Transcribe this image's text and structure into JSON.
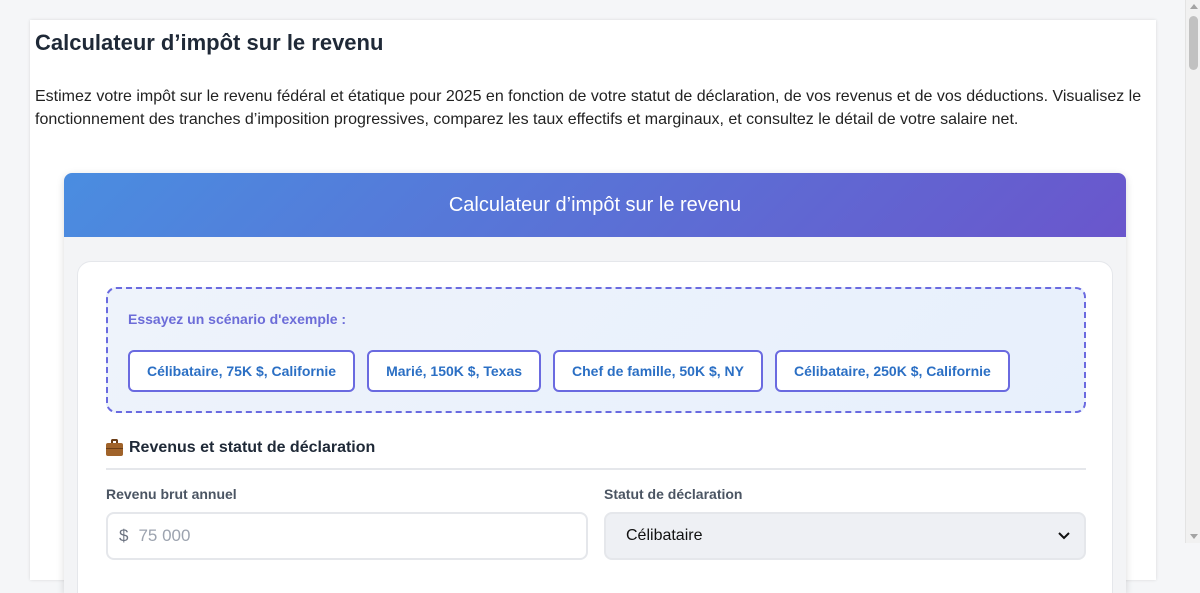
{
  "page": {
    "title": "Calculateur d’impôt sur le revenu",
    "intro": "Estimez votre impôt sur le revenu fédéral et étatique pour 2025 en fonction de votre statut de déclaration, de vos revenus et de vos déductions. Visualisez le fonctionnement des tranches d’imposition progressives, comparez les taux effectifs et marginaux, et consultez le détail de votre salaire net."
  },
  "calculator": {
    "header": "Calculateur d’impôt sur le revenu",
    "scenarios": {
      "label": "Essayez un scénario d'exemple :",
      "buttons": [
        "Célibataire, 75K $, Californie",
        "Marié, 150K $, Texas",
        "Chef de famille, 50K $, NY",
        "Célibataire, 250K $, Californie"
      ]
    },
    "section": {
      "icon": "briefcase-icon",
      "title": "Revenus et statut de déclaration"
    },
    "income": {
      "label": "Revenu brut annuel",
      "currency": "$",
      "placeholder": "75 000",
      "value": ""
    },
    "filing_status": {
      "label": "Statut de déclaration",
      "selected": "Célibataire"
    }
  },
  "colors": {
    "header_gradient_start": "#4a8de0",
    "header_gradient_end": "#6a56cc",
    "accent": "#6a6ae0",
    "button_text": "#2b6fc4"
  }
}
